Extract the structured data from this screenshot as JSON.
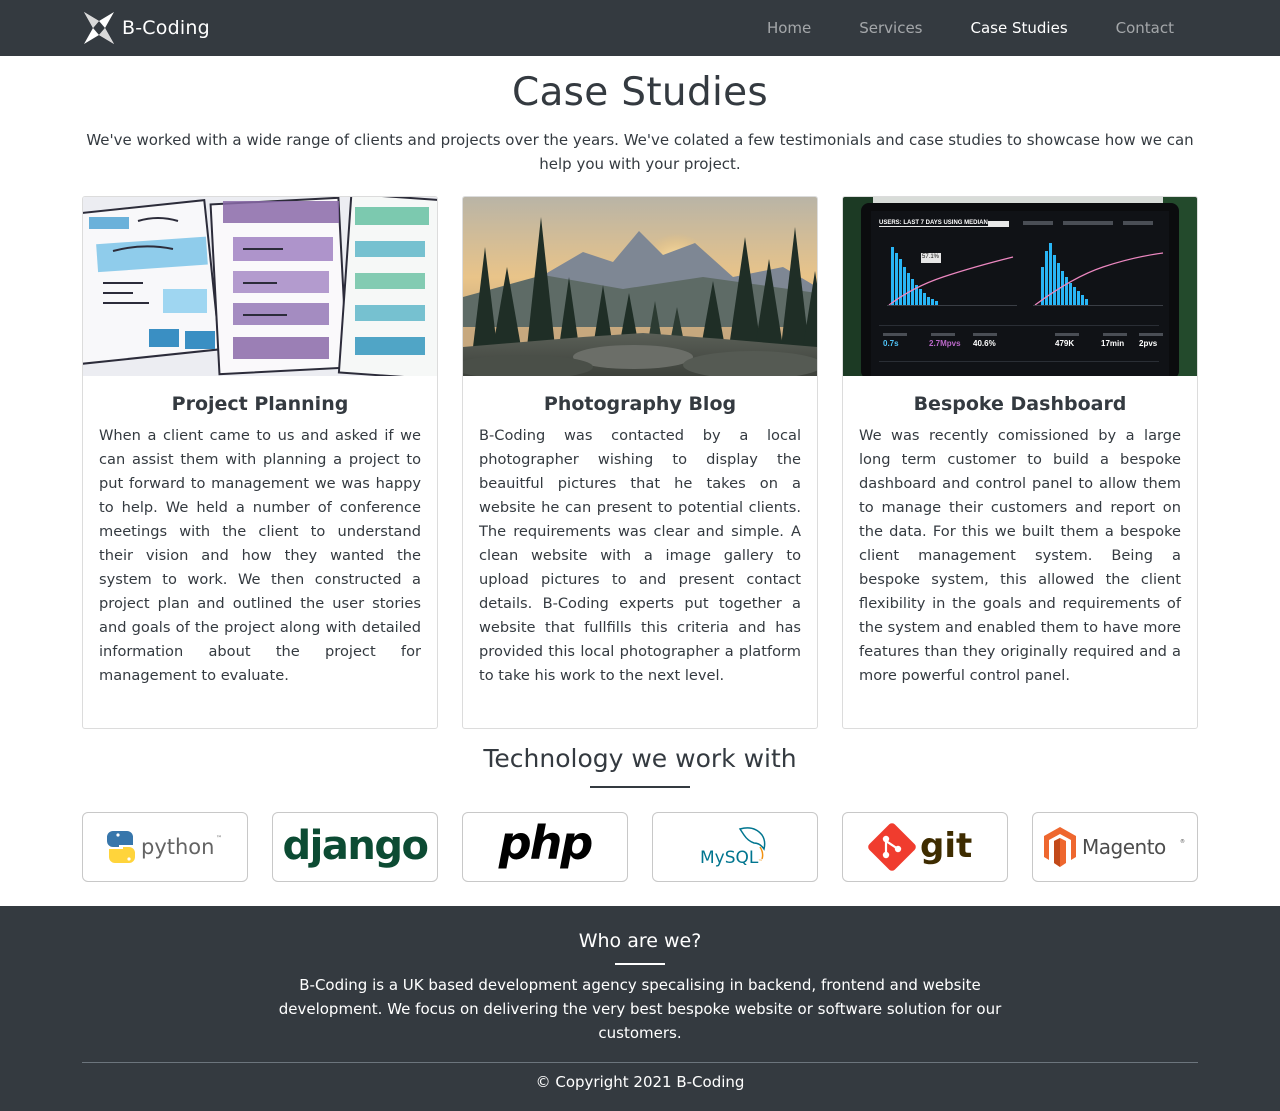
{
  "navbar": {
    "brand": "B-Coding",
    "links": [
      {
        "label": "Home",
        "active": false
      },
      {
        "label": "Services",
        "active": false
      },
      {
        "label": "Case Studies",
        "active": true
      },
      {
        "label": "Contact",
        "active": false
      }
    ]
  },
  "hero": {
    "title": "Case Studies",
    "intro": "We've worked with a wide range of clients and projects over the years. We've colated a few testimonials and case studies to showcase how we can help you with your project."
  },
  "cases": [
    {
      "image": "wireframe-sketch-image",
      "title": "Project Planning",
      "text": "When a client came to us and asked if we can assist them with planning a project to put forward to management we was happy to help. We held a number of conference meetings with the client to understand their vision and how they wanted the system to work. We then constructed a project plan and outlined the user stories and goals of the project along with detailed information about the project for management to evaluate."
    },
    {
      "image": "mountain-forest-sunset-image",
      "title": "Photography Blog",
      "text": "B-Coding was contacted by a local photographer wishing to display the beauitful pictures that he takes on a website he can present to potential clients. The requirements was clear and simple. A clean website with a image gallery to upload pictures to and present contact details. B-Coding experts put together a website that fullfills this criteria and has provided this local photographer a platform to take his work to the next level."
    },
    {
      "image": "analytics-dashboard-laptop-image",
      "title": "Bespoke Dashboard",
      "text": "We was recently comissioned by a large long term customer to build a bespoke dashboard and control panel to allow them to manage their customers and report on the data. For this we built them a bespoke client management system. Being a bespoke system, this allowed the client flexibility in the goals and requirements of the system and enabled them to have more features than they originally required and a more powerful control panel."
    }
  ],
  "dashboard_screen": {
    "header": "USERS: LAST 7 DAYS USING MEDIAN",
    "tooltip": "57.1%",
    "stats": [
      {
        "value": "0.7s",
        "color": "#4fc3f7"
      },
      {
        "value": "2.7Mpvs",
        "color": "#ba68c8"
      },
      {
        "value": "40.6%",
        "color": "#ffffff"
      },
      {
        "value": "479K",
        "color": "#ffffff"
      },
      {
        "value": "17min",
        "color": "#ffffff"
      },
      {
        "value": "2pvs",
        "color": "#ffffff"
      }
    ]
  },
  "technology": {
    "title": "Technology we work with",
    "logos": [
      {
        "name": "python",
        "text": "python",
        "tm": "™",
        "color": "#646464"
      },
      {
        "name": "django",
        "text": "django",
        "color": "#0c4b33"
      },
      {
        "name": "php",
        "text": "php",
        "color": "#000000"
      },
      {
        "name": "mysql",
        "text": "MySQL",
        "tm": "™",
        "color": "#00758f"
      },
      {
        "name": "git",
        "text": "git",
        "color": "#3e2c00"
      },
      {
        "name": "magento",
        "text": "Magento",
        "tm": "®",
        "color": "#ee672f"
      }
    ]
  },
  "footer": {
    "title": "Who are we?",
    "text": "B-Coding is a UK based development agency specalising in backend, frontend and website development. We focus on delivering the very best bespoke website or software solution for our customers.",
    "copyright": "© Copyright 2021 B-Coding"
  },
  "colors": {
    "navbar_bg": "#343a40",
    "text": "#343a40",
    "footer_bg": "#343a40",
    "nav_inactive": "rgba(255,255,255,0.55)"
  }
}
